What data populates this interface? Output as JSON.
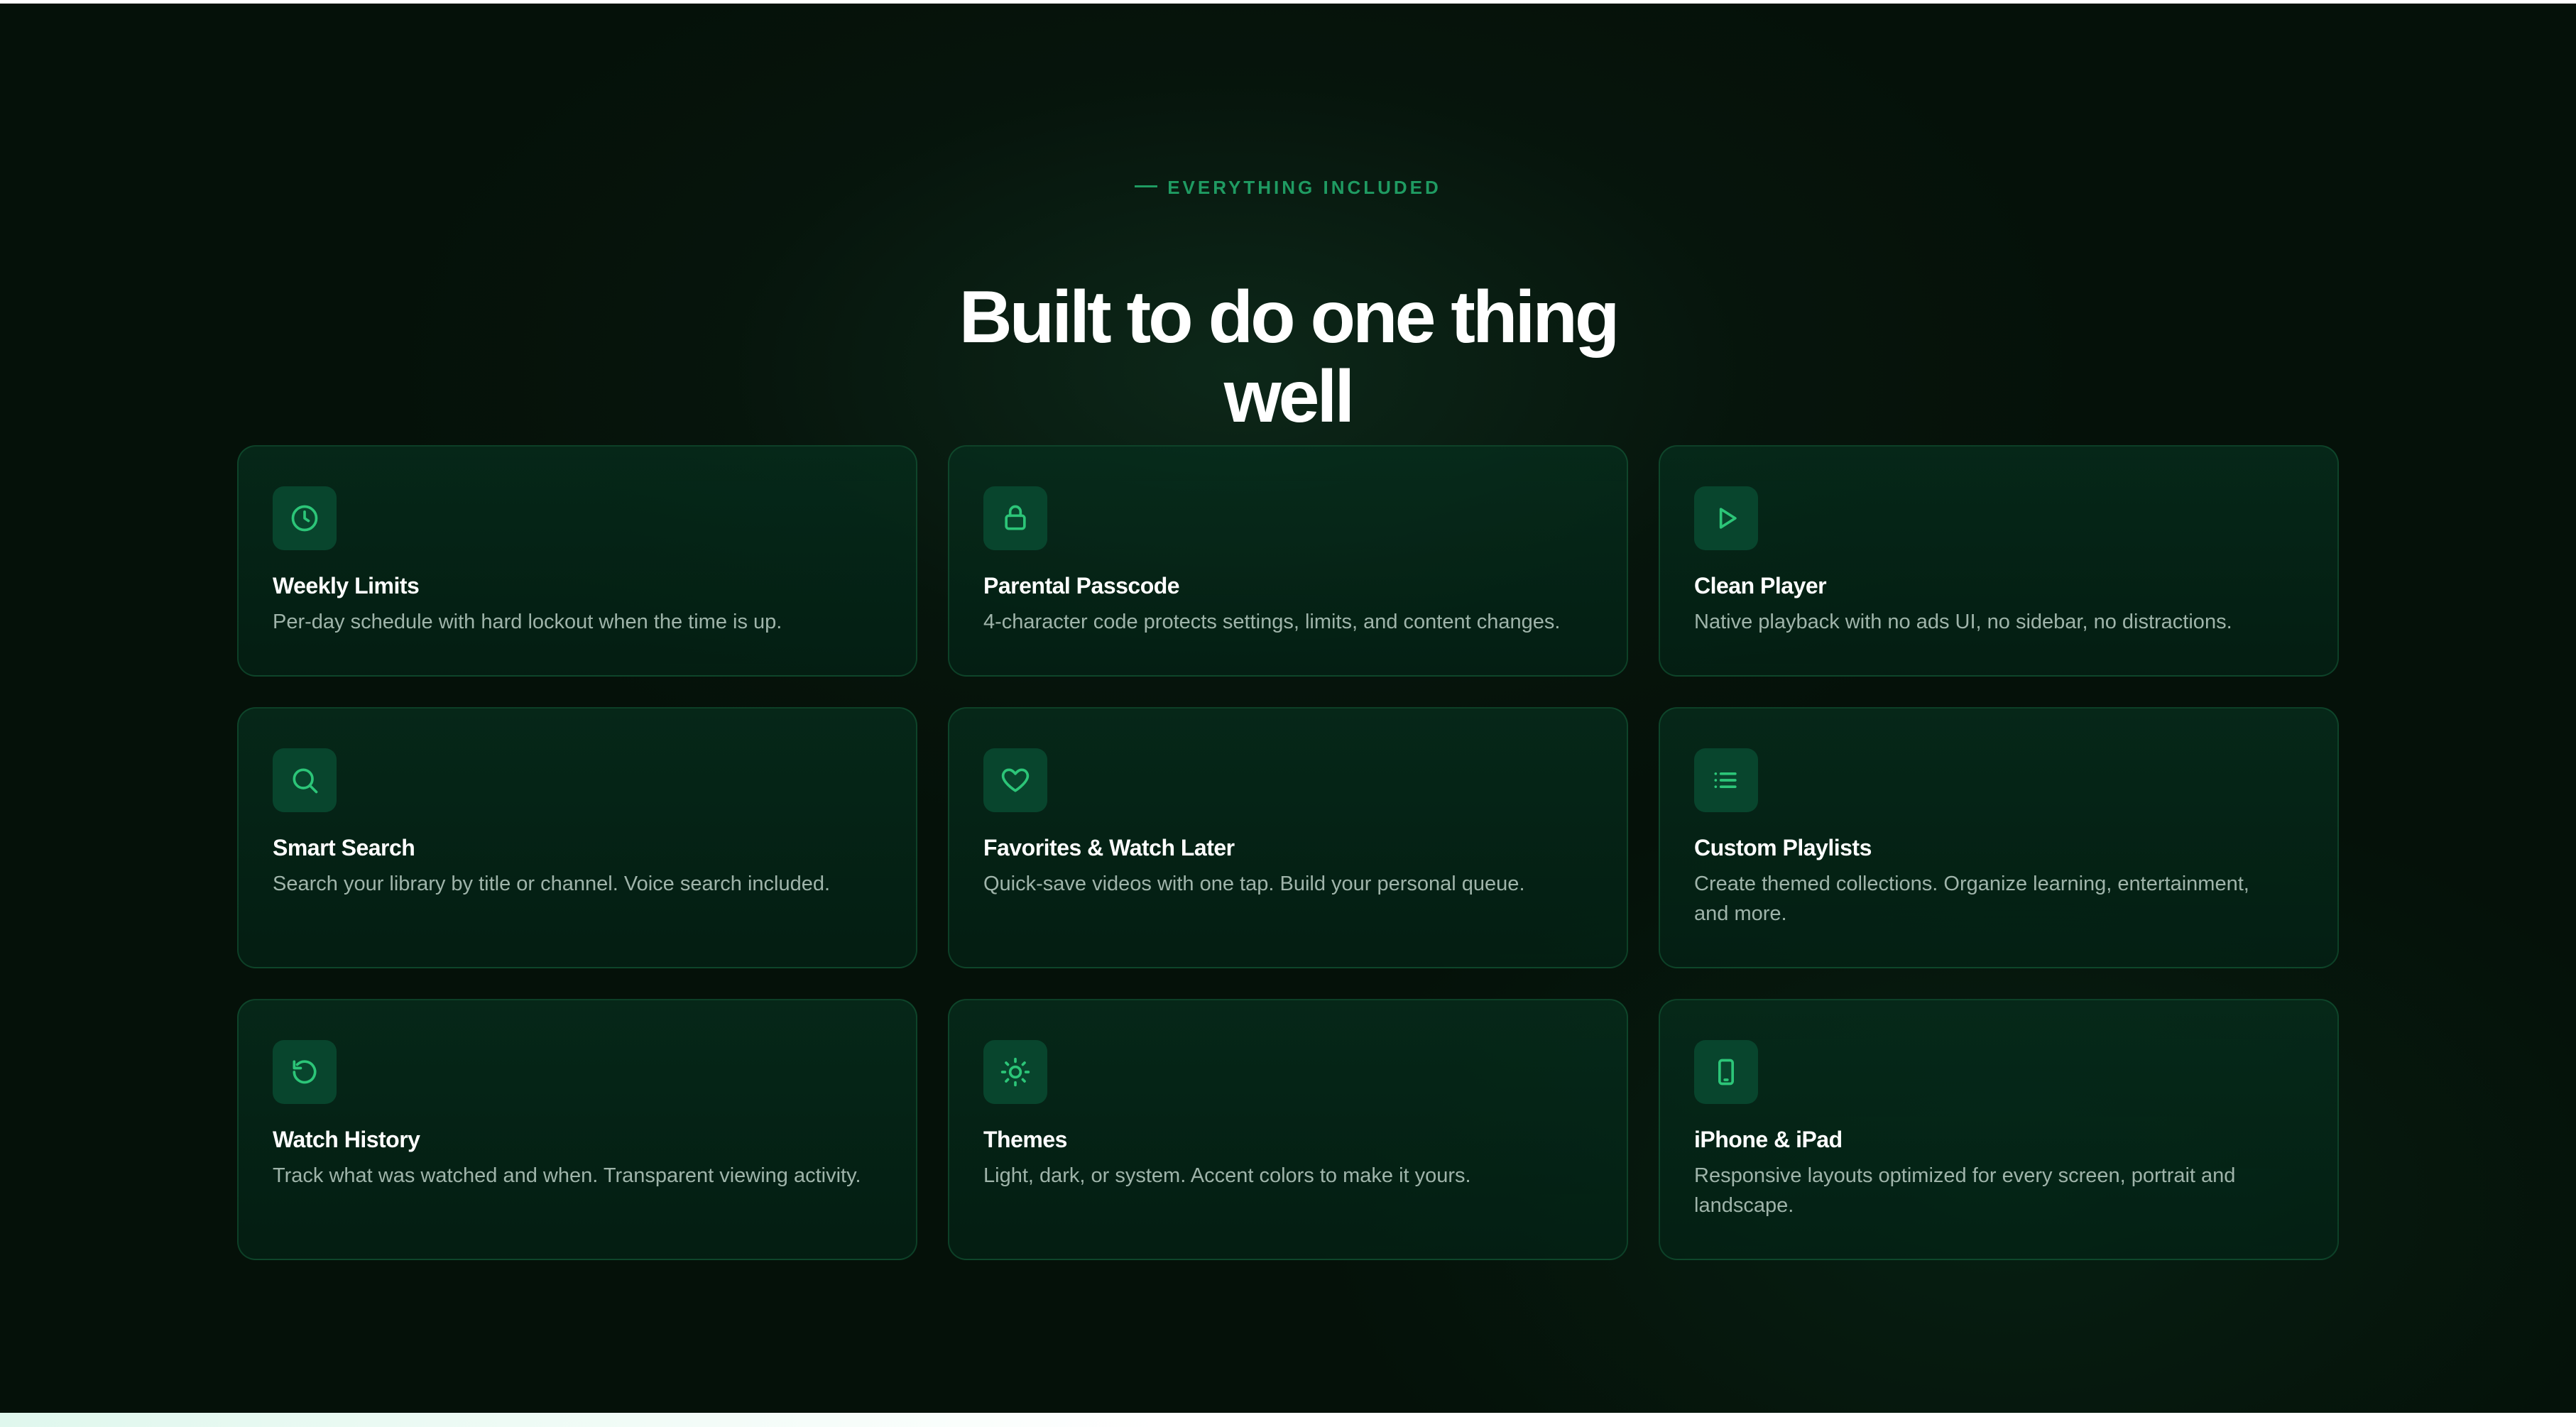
{
  "section": {
    "eyebrow": "EVERYTHING INCLUDED",
    "headline_line_1": "Built to do one thing",
    "headline_line_2": "well"
  },
  "features": [
    {
      "icon": "clock-icon",
      "title": "Weekly Limits",
      "description": "Per-day schedule with hard lockout when the time is up."
    },
    {
      "icon": "lock-icon",
      "title": "Parental Passcode",
      "description": "4-character code protects settings, limits, and content changes."
    },
    {
      "icon": "play-icon",
      "title": "Clean Player",
      "description": "Native playback with no ads UI, no sidebar, no distractions."
    },
    {
      "icon": "search-icon",
      "title": "Smart Search",
      "description": "Search your library by title or channel. Voice search included."
    },
    {
      "icon": "heart-icon",
      "title": "Favorites & Watch Later",
      "description": "Quick-save videos with one tap. Build your personal queue."
    },
    {
      "icon": "list-icon",
      "title": "Custom Playlists",
      "description": "Create themed collections. Organize learning, entertainment, and more."
    },
    {
      "icon": "history-icon",
      "title": "Watch History",
      "description": "Track what was watched and when. Transparent viewing activity."
    },
    {
      "icon": "sun-icon",
      "title": "Themes",
      "description": "Light, dark, or system. Accent colors to make it yours."
    },
    {
      "icon": "tablet-icon",
      "title": "iPhone & iPad",
      "description": "Responsive layouts optimized for every screen, portrait and landscape."
    }
  ],
  "colors": {
    "background": "#051109",
    "accent": "#2cc578",
    "card_border": "#1c6f46",
    "title": "#ffffff",
    "description": "#9fb4aa"
  }
}
